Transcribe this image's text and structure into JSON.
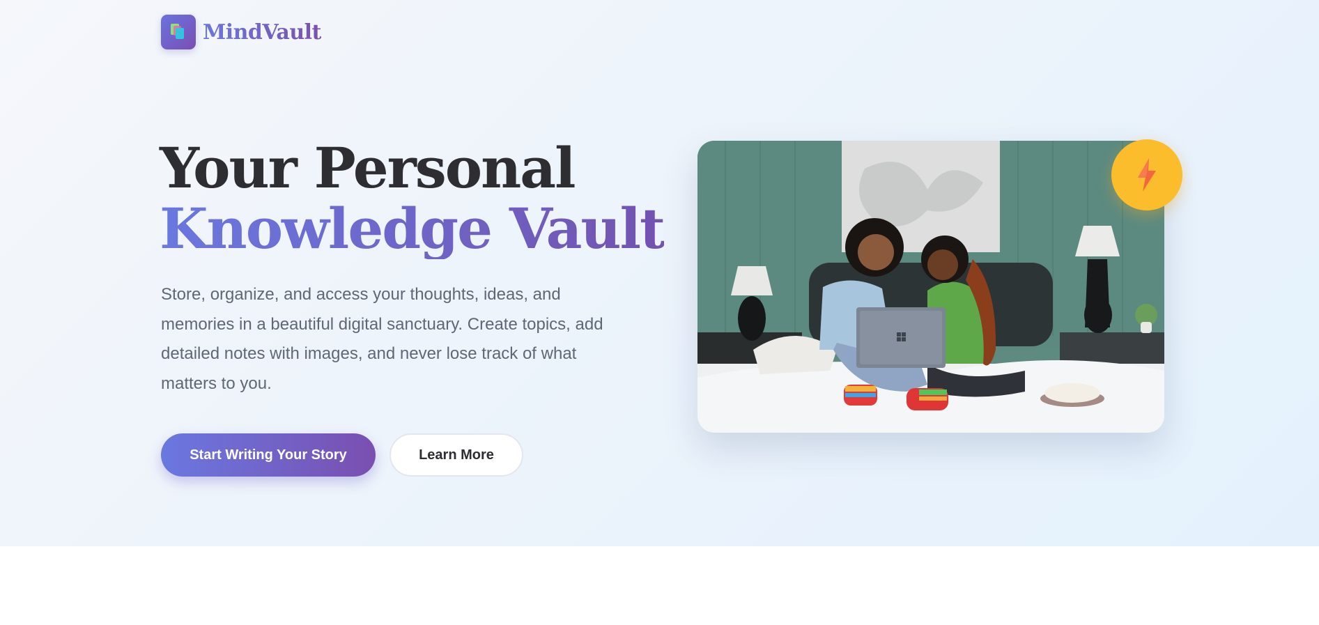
{
  "brand": {
    "name": "MindVault",
    "logo_icon": "stacked-notes-icon"
  },
  "hero": {
    "title_line1": "Your Personal",
    "title_line2": "Knowledge Vault",
    "description": "Store, organize, and access your thoughts, ideas, and memories in a beautiful digital sanctuary. Create topics, add detailed notes with images, and never lose track of what matters to you.",
    "primary_cta": "Start Writing Your Story",
    "secondary_cta": "Learn More",
    "badge_icon": "lightning-bolt-icon"
  },
  "colors": {
    "accent_start": "#6a78e0",
    "accent_end": "#7a4fb0",
    "title_dark": "#2d2d32",
    "body_text": "#5f6775",
    "badge": "#fbbd2b",
    "bolt": "#f4663f"
  }
}
